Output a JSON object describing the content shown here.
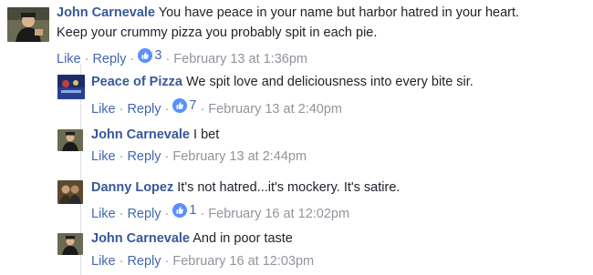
{
  "comments": [
    {
      "author": "John Carnevale",
      "line1": "You have peace in your name but harbor hatred in your heart.",
      "line2": "Keep your crummy pizza you probably spit in each pie.",
      "like": "Like",
      "reply": "Reply",
      "reactions": "3",
      "timestamp": "February 13 at 1:36pm"
    }
  ],
  "replies": [
    {
      "author": "Peace of Pizza",
      "text": "We spit love and deliciousness into every bite sir.",
      "like": "Like",
      "reply": "Reply",
      "reactions": "7",
      "timestamp": "February 13 at 2:40pm"
    },
    {
      "author": "John Carnevale",
      "text": "I bet",
      "like": "Like",
      "reply": "Reply",
      "timestamp": "February 13 at 2:44pm"
    },
    {
      "author": "Danny Lopez",
      "text": "It's not hatred...it's mockery. It's satire.",
      "like": "Like",
      "reply": "Reply",
      "reactions": "1",
      "timestamp": "February 16 at 12:02pm"
    },
    {
      "author": "John Carnevale",
      "text": "And in poor taste",
      "like": "Like",
      "reply": "Reply",
      "timestamp": "February 16 at 12:03pm"
    }
  ],
  "icons": {
    "reaction": "like-thumb-icon"
  },
  "colors": {
    "author": "#365899",
    "link": "#4267b2",
    "meta": "#90949c",
    "like_badge": "#5890ff"
  }
}
